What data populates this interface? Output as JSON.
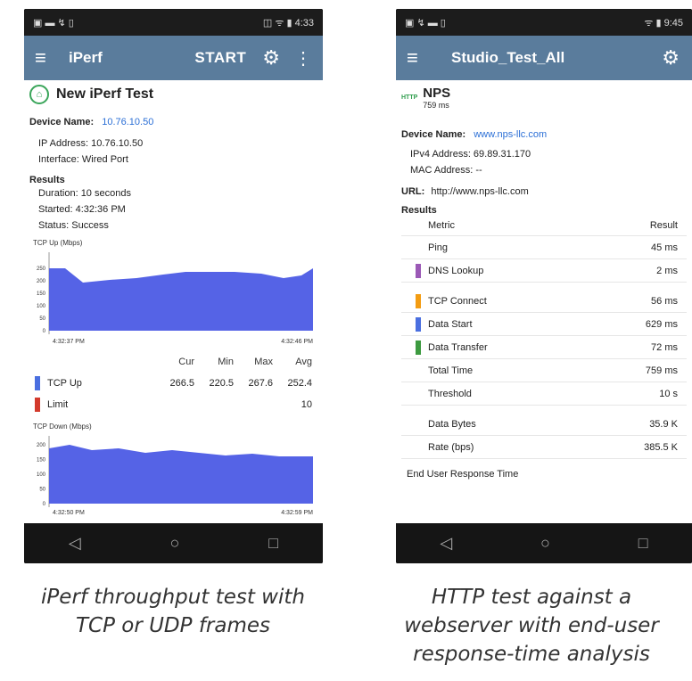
{
  "left": {
    "status_left": "▣ ▬ ↯ ▯",
    "status_right": "◫ ᯤ ▮ 4:33",
    "appbar": {
      "title": "iPerf",
      "start": "START"
    },
    "test_title": "New iPerf Test",
    "device_name_label": "Device Name:",
    "device_name_value": "10.76.10.50",
    "ip_address": "IP Address: 10.76.10.50",
    "interface": "Interface: Wired Port",
    "results_label": "Results",
    "duration": "Duration: 10 seconds",
    "started": "Started: 4:32:36 PM",
    "status": "Status: Success",
    "chart1": {
      "title": "TCP Up (Mbps)",
      "ticks": [
        "250",
        "200",
        "150",
        "100",
        "50",
        "0"
      ],
      "x_start": "4:32:37 PM",
      "x_end": "4:32:46 PM"
    },
    "stats": {
      "headers": [
        "Cur",
        "Min",
        "Max",
        "Avg"
      ],
      "tcp_up": {
        "label": "TCP Up",
        "cur": "266.5",
        "min": "220.5",
        "max": "267.6",
        "avg": "252.4",
        "color": "#4a6fe0"
      },
      "limit": {
        "label": "Limit",
        "value": "10",
        "color": "#d33a2c"
      }
    },
    "chart2": {
      "title": "TCP Down (Mbps)",
      "ticks": [
        "200",
        "150",
        "100",
        "50",
        "0"
      ],
      "x_start": "4:32:50 PM",
      "x_end": "4:32:59 PM"
    },
    "caption_line1": "iPerf throughput test with",
    "caption_line2": "TCP or UDP frames"
  },
  "right": {
    "status_left": "▣ ↯ ▬ ▯",
    "status_right": "ᯤ ▮ 9:45",
    "appbar": {
      "title": "Studio_Test_All"
    },
    "badge": "HTTP",
    "test_title": "NPS",
    "test_time": "759 ms",
    "device_name_label": "Device Name:",
    "device_name_value": "www.nps-llc.com",
    "ipv4": "IPv4 Address: 69.89.31.170",
    "mac": "MAC Address: --",
    "url_label": "URL:",
    "url_value": "http://www.nps-llc.com",
    "results_label": "Results",
    "table_headers": [
      "Metric",
      "Result"
    ],
    "rows": [
      {
        "metric": "Ping",
        "result": "45 ms",
        "color": ""
      },
      {
        "metric": "DNS Lookup",
        "result": "2 ms",
        "color": "#9b59b6"
      },
      {
        "metric": "TCP Connect",
        "result": "56 ms",
        "color": "#f39c12"
      },
      {
        "metric": "Data Start",
        "result": "629 ms",
        "color": "#4a6fe0"
      },
      {
        "metric": "Data Transfer",
        "result": "72 ms",
        "color": "#3d9a40"
      },
      {
        "metric": "Total Time",
        "result": "759 ms",
        "color": ""
      },
      {
        "metric": "Threshold",
        "result": "10 s",
        "color": ""
      },
      {
        "metric": "Data Bytes",
        "result": "35.9 K",
        "color": ""
      },
      {
        "metric": "Rate (bps)",
        "result": "385.5 K",
        "color": ""
      }
    ],
    "footer": "End User Response Time",
    "caption_line1": "HTTP test against a",
    "caption_line2": "webserver with end-user",
    "caption_line3": "response-time analysis"
  },
  "colors": {
    "appbar": "#5a7c9c",
    "chart_fill": "#5563e6"
  }
}
